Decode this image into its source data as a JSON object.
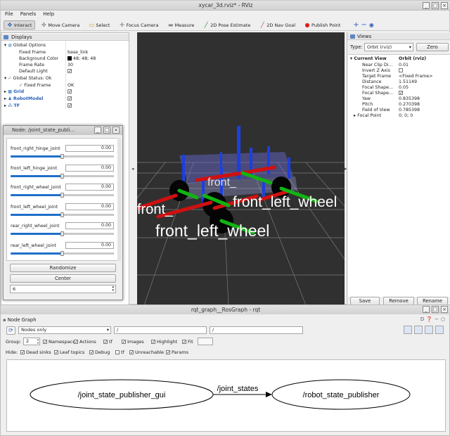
{
  "rviz": {
    "title": "xycar_3d.rviz* - RViz",
    "menu": [
      "File",
      "Panels",
      "Help"
    ],
    "toolbar": [
      {
        "label": "Interact",
        "icon": "interact-icon",
        "active": true
      },
      {
        "label": "Move Camera",
        "icon": "move-camera-icon"
      },
      {
        "label": "Select",
        "icon": "select-icon"
      },
      {
        "label": "Focus Camera",
        "icon": "focus-camera-icon"
      },
      {
        "label": "Measure",
        "icon": "measure-icon"
      },
      {
        "label": "2D Pose Estimate",
        "icon": "pose-estimate-icon"
      },
      {
        "label": "2D Nav Goal",
        "icon": "nav-goal-icon"
      },
      {
        "label": "Publish Point",
        "icon": "publish-point-icon"
      }
    ],
    "displays": {
      "header": "Displays",
      "global_options": "Global Options",
      "fixed_frame_label": "Fixed Frame",
      "fixed_frame_value": "base_link",
      "background_color_label": "Background Color",
      "background_color_value": "48; 48; 48",
      "background_color_swatch": "#303030",
      "frame_rate_label": "Frame Rate",
      "frame_rate_value": "30",
      "default_light_label": "Default Light",
      "global_status": "Global Status: Ok",
      "status_fixed_frame_label": "Fixed Frame",
      "status_fixed_frame_value": "OK",
      "grid": "Grid",
      "robot_model": "RobotModel",
      "tf": "TF"
    },
    "views": {
      "header": "Views",
      "type_label": "Type:",
      "type_value": "Orbit (rviz)",
      "zero_button": "Zero",
      "current_view": "Current View",
      "current_view_value": "Orbit (rviz)",
      "props": [
        {
          "label": "Near Clip Di...",
          "value": "0.01"
        },
        {
          "label": "Invert Z Axis",
          "value": ""
        },
        {
          "label": "Target Frame",
          "value": "<Fixed Frame>"
        },
        {
          "label": "Distance",
          "value": "1.51149"
        },
        {
          "label": "Focal Shape...",
          "value": "0.05"
        },
        {
          "label": "Focal Shape...",
          "value": ""
        },
        {
          "label": "Yaw",
          "value": "0.835398"
        },
        {
          "label": "Pitch",
          "value": "0.270398"
        },
        {
          "label": "Field of View",
          "value": "0.785398"
        },
        {
          "label": "Focal Point",
          "value": "0; 0; 0"
        }
      ],
      "save_button": "Save",
      "remove_button": "Remove",
      "rename_button": "Rename"
    },
    "viewport_labels": [
      "front_left_wheel",
      "front_left_wheel",
      "front_",
      "front_"
    ]
  },
  "node_window": {
    "title": "Node: /joint_state_publi...",
    "joints": [
      {
        "name": "front_right_hinge_joint",
        "value": "0.00",
        "level": 0.5
      },
      {
        "name": "front_left_hinge_joint",
        "value": "0.00",
        "level": 0.5
      },
      {
        "name": "front_right_wheel_joint",
        "value": "0.00",
        "level": 0.5
      },
      {
        "name": "front_left_wheel_joint",
        "value": "0.00",
        "level": 0.5
      },
      {
        "name": "rear_right_wheel_joint",
        "value": "0.00",
        "level": 0.5
      },
      {
        "name": "rear_left_wheel_joint",
        "value": "0.00",
        "level": 0.5
      }
    ],
    "randomize_button": "Randomize",
    "center_button": "Center",
    "count_value": "6"
  },
  "rqt": {
    "title": "rqt_graph__RosGraph - rqt",
    "plugin_title": "Node Graph",
    "mode_value": "Nodes only",
    "filter1": "/",
    "filter2": "/",
    "group_label": "Group:",
    "group_value": "2",
    "group_options": [
      {
        "label": "Namespaces",
        "checked": true
      },
      {
        "label": "Actions",
        "checked": true
      },
      {
        "label": "tf",
        "checked": true
      },
      {
        "label": "Images",
        "checked": true
      },
      {
        "label": "Highlight",
        "checked": true
      },
      {
        "label": "Fit",
        "checked": true
      }
    ],
    "hide_label": "Hide:",
    "hide_options": [
      {
        "label": "Dead sinks",
        "checked": true
      },
      {
        "label": "Leaf topics",
        "checked": true
      },
      {
        "label": "Debug",
        "checked": true
      },
      {
        "label": "tf",
        "checked": false
      },
      {
        "label": "Unreachable",
        "checked": true
      },
      {
        "label": "Params",
        "checked": true
      }
    ],
    "graph": {
      "node_left": "/joint_state_publisher_gui",
      "edge": "/joint_states",
      "node_right": "/robot_state_publisher"
    }
  }
}
